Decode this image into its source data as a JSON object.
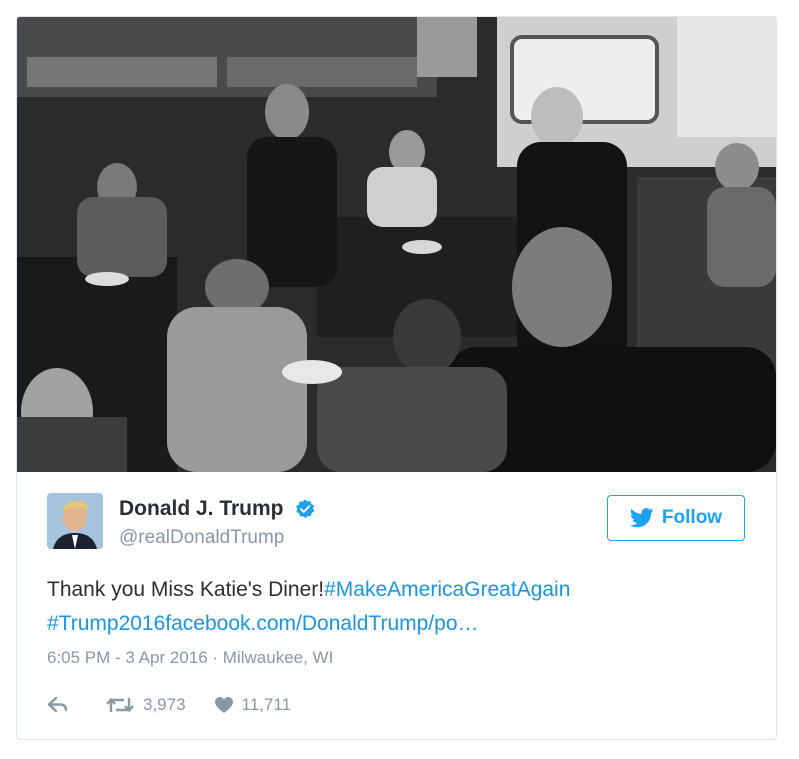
{
  "tweet": {
    "author_name": "Donald J. Trump",
    "author_handle": "@realDonaldTrump",
    "follow_label": "Follow",
    "text_plain": "Thank you Miss Katie's Diner!",
    "hashtag1": "#MakeAmericaGreatAgain",
    "hashtag2": "#Trump2016",
    "link_text": "facebook.com/DonaldTrump/po…",
    "timestamp": "6:05 PM - 3 Apr 2016",
    "separator": "·",
    "location": "Milwaukee, WI",
    "retweet_count": "3,973",
    "like_count": "11,711"
  },
  "colors": {
    "accent": "#1da1f2",
    "link": "#1b95e0",
    "text": "#292f33",
    "muted": "#8899a6",
    "border": "#e1e8ed"
  },
  "icons": {
    "verified": "verified-badge-icon",
    "twitter_bird": "twitter-bird-icon",
    "reply": "reply-icon",
    "retweet": "retweet-icon",
    "like": "heart-icon"
  }
}
